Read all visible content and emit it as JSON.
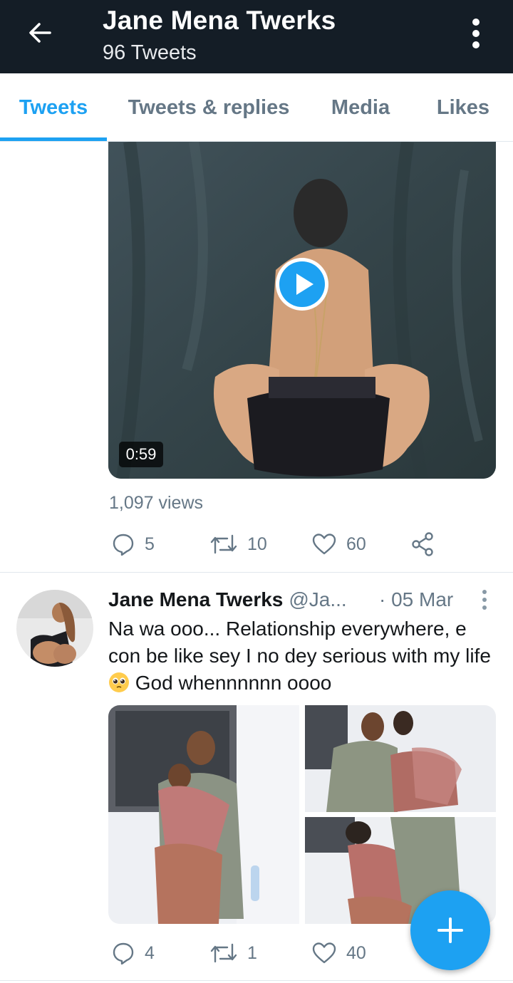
{
  "header": {
    "title": "Jane Mena Twerks",
    "subtitle": "96 Tweets",
    "back_icon": "arrow-left-icon",
    "more_icon": "kebab-vertical-icon",
    "background": "#141d26"
  },
  "tabs": [
    {
      "label": "Tweets",
      "active": true
    },
    {
      "label": "Tweets & replies",
      "active": false
    },
    {
      "label": "Media",
      "active": false
    },
    {
      "label": "Likes",
      "active": false
    }
  ],
  "accent_color": "#1da1f2",
  "video_tweet": {
    "duration": "0:59",
    "views": "1,097 views",
    "replies": "5",
    "retweets": "10",
    "likes": "60"
  },
  "photo_tweet": {
    "name": "Jane Mena Twerks",
    "handle": "@Ja...",
    "date": "· 05 Mar",
    "text_before_emoji": "Na wa ooo... Relationship everywhere, e con be like sey I no dey serious with my life ",
    "emoji": "pleading-face-emoji",
    "text_after_emoji": " God whennnnnn oooo",
    "replies": "4",
    "retweets": "1",
    "likes": "40"
  },
  "fab": {
    "icon": "plus-icon"
  }
}
